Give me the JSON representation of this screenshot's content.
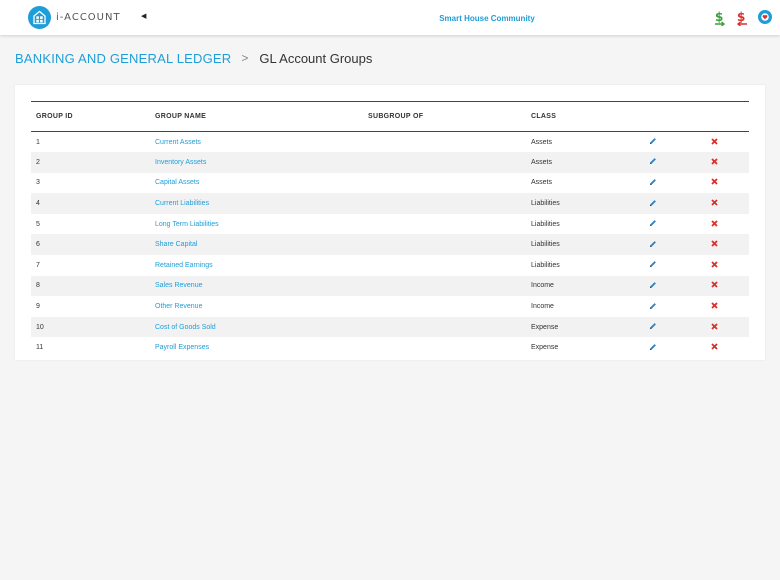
{
  "app": {
    "logo_text": "i-ACCOUNT",
    "community": "Smart House Community"
  },
  "breadcrumb": {
    "parent": "BANKING AND GENERAL LEDGER",
    "separator": ">",
    "current": "GL Account Groups"
  },
  "colors": {
    "accent": "#1e9ed8",
    "dollar_green": "#3aa03a",
    "dollar_red": "#d9302c",
    "delete_red": "#d9302c"
  },
  "icons": {
    "logo": "house-grid-icon",
    "collapse": "caret-left-icon",
    "top": [
      "dollar-green-icon",
      "dollar-red-icon",
      "heart-icon"
    ],
    "row_actions": [
      "pencil-icon",
      "close-icon"
    ]
  },
  "table": {
    "columns": [
      "GROUP ID",
      "GROUP NAME",
      "SUBGROUP OF",
      "CLASS",
      "",
      ""
    ],
    "rows": [
      {
        "id": "1",
        "name": "Current Assets",
        "subgroup": "",
        "class": "Assets"
      },
      {
        "id": "2",
        "name": "Inventory Assets",
        "subgroup": "",
        "class": "Assets"
      },
      {
        "id": "3",
        "name": "Capital Assets",
        "subgroup": "",
        "class": "Assets"
      },
      {
        "id": "4",
        "name": "Current Liabilities",
        "subgroup": "",
        "class": "Liabilities"
      },
      {
        "id": "5",
        "name": "Long Term Liabilities",
        "subgroup": "",
        "class": "Liabilities"
      },
      {
        "id": "6",
        "name": "Share Capital",
        "subgroup": "",
        "class": "Liabilities"
      },
      {
        "id": "7",
        "name": "Retained Earnings",
        "subgroup": "",
        "class": "Liabilities"
      },
      {
        "id": "8",
        "name": "Sales Revenue",
        "subgroup": "",
        "class": "Income"
      },
      {
        "id": "9",
        "name": "Other Revenue",
        "subgroup": "",
        "class": "Income"
      },
      {
        "id": "10",
        "name": "Cost of Goods Sold",
        "subgroup": "",
        "class": "Expense"
      },
      {
        "id": "11",
        "name": "Payroll Expenses",
        "subgroup": "",
        "class": "Expense"
      }
    ]
  }
}
